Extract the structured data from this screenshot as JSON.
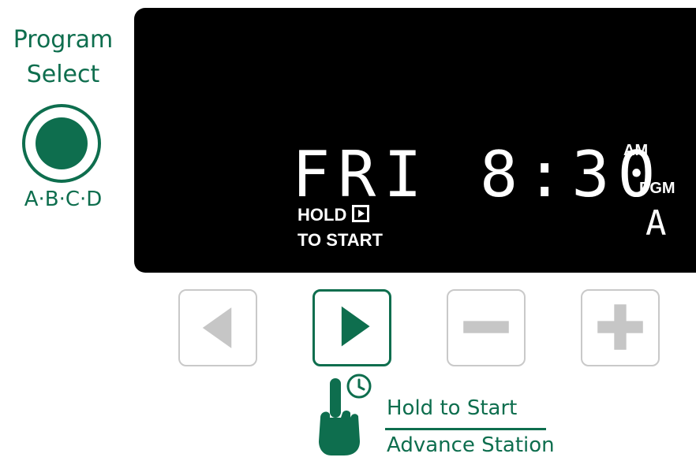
{
  "program_select": {
    "label_line1": "Program",
    "label_line2": "Select",
    "options": "A·B·C·D",
    "icon": "program-select-dial-icon",
    "accent_color": "#0e6e4e"
  },
  "display": {
    "day": "FRI",
    "time": "8:30",
    "am_pm": "AM",
    "hold_label": "HOLD",
    "to_start_label": "TO START",
    "pgm_label": "PGM",
    "program_letter": "A",
    "background_color": "#000000"
  },
  "buttons": {
    "back": {
      "icon": "left-arrow-icon",
      "state": "inactive"
    },
    "advance": {
      "icon": "right-arrow-icon",
      "state": "active"
    },
    "minus": {
      "icon": "minus-icon",
      "state": "inactive"
    },
    "plus": {
      "icon": "plus-icon",
      "state": "inactive"
    }
  },
  "hint": {
    "line1": "Hold to Start",
    "line2": "Advance Station",
    "icons": [
      "pointing-hand-icon",
      "clock-icon"
    ]
  }
}
